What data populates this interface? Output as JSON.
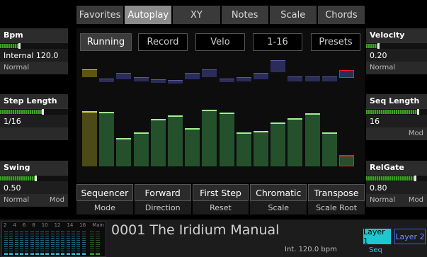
{
  "tabs": [
    "Favorites",
    "Autoplay",
    "XY",
    "Notes",
    "Scale",
    "Chords"
  ],
  "active_tab": 1,
  "left_params": [
    {
      "label": "Bpm",
      "level": 0.28,
      "value": "Internal 120.0",
      "sub": [
        "Normal",
        ""
      ]
    },
    {
      "label": "Step Length",
      "level": 0.62,
      "value": "1/16",
      "sub": [
        "",
        ""
      ]
    },
    {
      "label": "Swing",
      "level": 0.52,
      "value": "0.50",
      "sub": [
        "Normal",
        "Mod"
      ]
    }
  ],
  "right_params": [
    {
      "label": "Velocity",
      "level": 0.2,
      "value": "0.20",
      "sub": [
        "Normal",
        ""
      ]
    },
    {
      "label": "Seq Length",
      "level": 0.85,
      "value": "16",
      "sub": [
        "",
        "Mod"
      ]
    },
    {
      "label": "RelGate",
      "level": 0.8,
      "value": "0.80",
      "sub": [
        "Normal",
        "Mod"
      ]
    }
  ],
  "seq_buttons": [
    "Running",
    "Record",
    "Velo",
    "1-16",
    "Presets"
  ],
  "steps_top": [
    0.62,
    0.3,
    0.5,
    0.35,
    0.28,
    0.25,
    0.5,
    0.62,
    0.3,
    0.35,
    0.5,
    0.95,
    0.38,
    0.38,
    0.38,
    0.6
  ],
  "steps_bottom": [
    0.97,
    0.96,
    0.5,
    0.6,
    0.84,
    0.9,
    0.67,
    1.0,
    0.95,
    0.6,
    0.63,
    0.77,
    0.85,
    0.94,
    0.6,
    0.2
  ],
  "step_colors": {
    "selected_top": "#5e5414",
    "selected_bottom": "#4c4a16",
    "selected_cap": "#d8d640",
    "normal_top": "#2c2c5a",
    "normal_bottom": "#25502c",
    "normal_cap": "#a0f090",
    "last_cap": "#e82020"
  },
  "bottom_buttons": [
    {
      "value": "Sequencer",
      "label": "Mode"
    },
    {
      "value": "Forward",
      "label": "Direction"
    },
    {
      "value": "First Step",
      "label": "Reset"
    },
    {
      "value": "Chromatic",
      "label": "Scale"
    },
    {
      "value": "Transpose",
      "label": "Scale Root"
    }
  ],
  "mixer_labels": [
    "2",
    "4",
    "6",
    "8",
    "10",
    "12",
    "14",
    "16",
    "Main"
  ],
  "preset_title": "0001 The Iridium Manual",
  "tempo": "Int. 120.0 bpm",
  "layers": [
    "Layer 1",
    "Layer 2"
  ],
  "layer_sub": "Seq"
}
